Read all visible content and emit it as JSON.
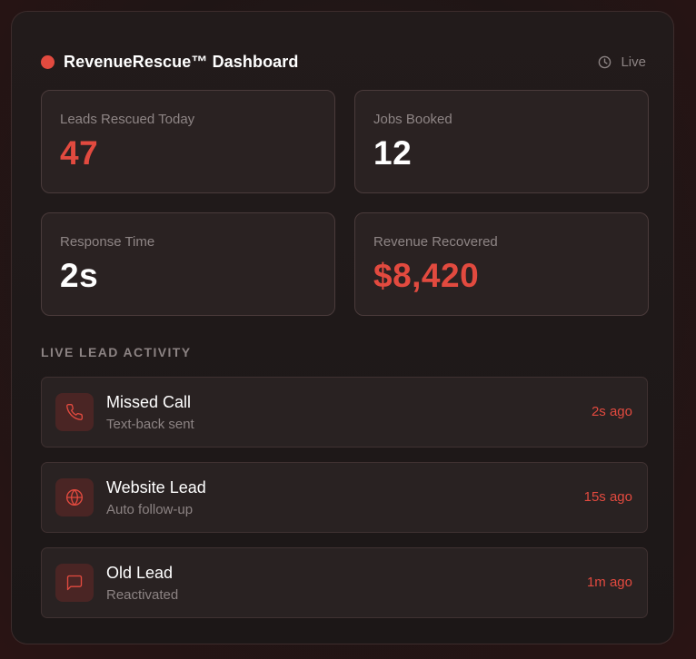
{
  "header": {
    "title": "RevenueRescue™ Dashboard",
    "status": "Live",
    "status_dot_color": "#e24a3f"
  },
  "stats": [
    {
      "label": "Leads Rescued Today",
      "value": "47",
      "accent": true
    },
    {
      "label": "Jobs Booked",
      "value": "12",
      "accent": false
    },
    {
      "label": "Response Time",
      "value": "2s",
      "accent": false
    },
    {
      "label": "Revenue Recovered",
      "value": "$8,420",
      "accent": true
    }
  ],
  "activity": {
    "title": "LIVE LEAD ACTIVITY",
    "items": [
      {
        "icon": "phone-icon",
        "name": "Missed Call",
        "detail": "Text-back sent",
        "time": "2s ago"
      },
      {
        "icon": "globe-icon",
        "name": "Website Lead",
        "detail": "Auto follow-up",
        "time": "15s ago"
      },
      {
        "icon": "message-icon",
        "name": "Old Lead",
        "detail": "Reactivated",
        "time": "1m ago"
      }
    ]
  },
  "colors": {
    "accent": "#e24a3f",
    "background": "#1e1616",
    "card": "#2a2222"
  }
}
